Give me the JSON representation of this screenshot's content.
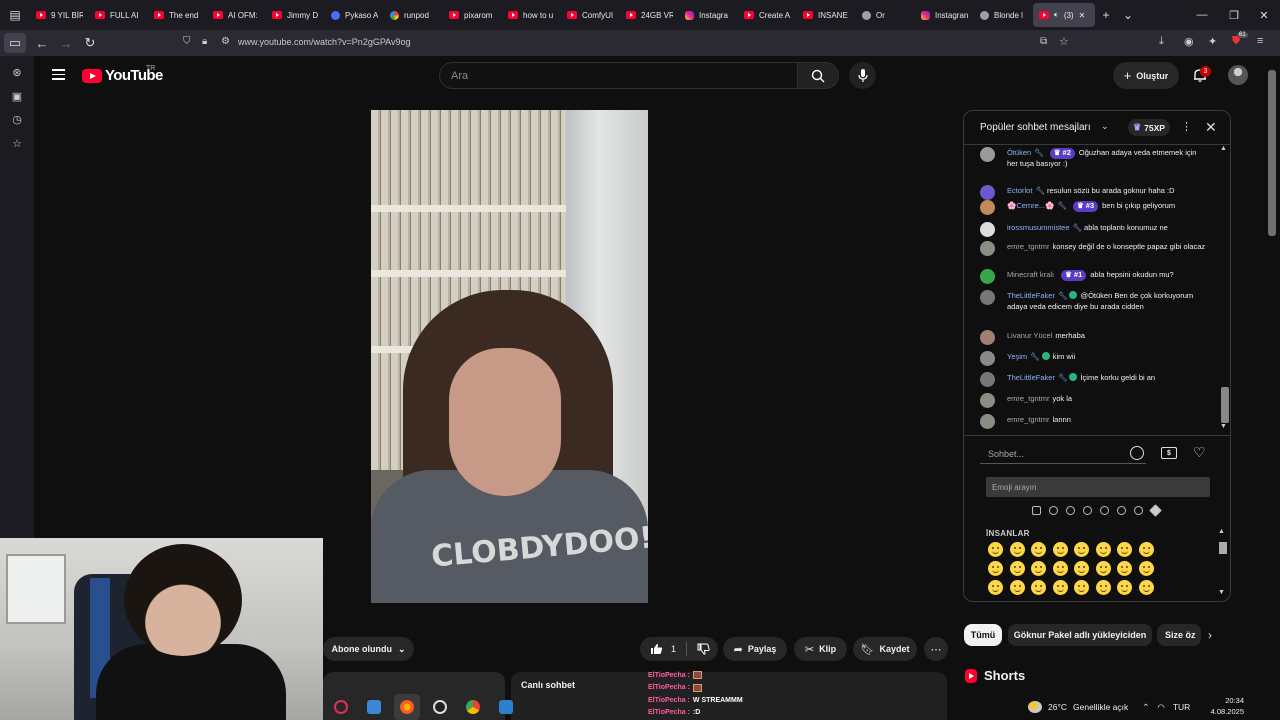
{
  "browser": {
    "tabs": [
      {
        "label": "9 YIL BİR",
        "icon": "youtube"
      },
      {
        "label": "FULL AI",
        "icon": "youtube"
      },
      {
        "label": "The end",
        "icon": "youtube"
      },
      {
        "label": "AI OFM:",
        "icon": "youtube"
      },
      {
        "label": "Jimmy D",
        "icon": "youtube"
      },
      {
        "label": "Pykaso A",
        "icon": "blue"
      },
      {
        "label": "runpod",
        "icon": "google"
      },
      {
        "label": "pixarom",
        "icon": "youtube"
      },
      {
        "label": "how to u",
        "icon": "youtube"
      },
      {
        "label": "ComfyUI",
        "icon": "youtube"
      },
      {
        "label": "24GB VR",
        "icon": "youtube"
      },
      {
        "label": "Instagra",
        "icon": "instagram"
      },
      {
        "label": "Create A",
        "icon": "youtube"
      },
      {
        "label": "INSANE",
        "icon": "youtube"
      },
      {
        "label": "Or",
        "icon": "emoji"
      },
      {
        "label": "Instagran",
        "icon": "instagram"
      },
      {
        "label": "Blonde l",
        "icon": "globe"
      },
      {
        "label": "(3)",
        "icon": "youtube",
        "active": true
      }
    ],
    "url": "www.youtube.com/watch?v=Pn2gGPAv9og",
    "extension_badge": "61"
  },
  "youtube": {
    "logo_text": "YouTube",
    "region": "TR",
    "search_placeholder": "Ara",
    "create_label": "Oluştur",
    "notifications_count": "3"
  },
  "video_actions": {
    "subscribe_label": "Abone olundu",
    "like_count": "1",
    "share_label": "Paylaş",
    "clip_label": "Klip",
    "save_label": "Kaydet"
  },
  "shirt_text": "CLOBDYDOO!",
  "live_chat_collapsed_label": "Canlı sohbet",
  "overlay_chat": [
    {
      "user": "ElTioPecha :",
      "msg": "",
      "emote": true
    },
    {
      "user": "ElTioPecha :",
      "msg": "",
      "emote": true
    },
    {
      "user": "ElTioPecha :",
      "msg": "W STREAMMM",
      "emote": false
    },
    {
      "user": "ElTioPecha :",
      "msg": ":D",
      "emote": false
    }
  ],
  "chat": {
    "title": "Popüler sohbet mesajları",
    "xp": "75XP",
    "messages": [
      {
        "author": "Ötüken",
        "member": true,
        "rank": "#2",
        "text": "Oğuzhan adaya veda etmemek için her tuşa basıyor :)",
        "avatar": "#9a9a9a"
      },
      {
        "author": "Ectorlot",
        "member": true,
        "rank": "",
        "text": "resulun sözü bu arada goknur haha :D",
        "avatar": "#6a5acd"
      },
      {
        "author": "🌸Cemre...🌸",
        "member": true,
        "rank": "#3",
        "text": "ben bi çıkıp geliyorum",
        "avatar": "#c08a5a"
      },
      {
        "author": "irossmusummistee",
        "member": true,
        "rank": "",
        "text": "abla toplantı konumuz ne",
        "avatar": "#dddddd"
      },
      {
        "author": "emre_tgntmr",
        "member": false,
        "rank": "",
        "text": "konsey değil de o konseptle papaz gibi olacaz",
        "avatar": "#8a8f86"
      },
      {
        "author": "Minecraft kralı",
        "member": false,
        "rank": "#1",
        "text": "abla hepsini okudun mu?",
        "avatar": "#3aa64a"
      },
      {
        "author": "TheLittleFaker",
        "member": true,
        "rank": "",
        "gem": true,
        "text": "@Ötüken Ben de çok korkuyorum adaya veda edicem diye bu arada cidden",
        "avatar": "#777777"
      },
      {
        "author": "Livanur Yücel",
        "member": false,
        "rank": "",
        "text": "merhaba",
        "avatar": "#a08070"
      },
      {
        "author": "Yeşim",
        "member": true,
        "rank": "",
        "gem": true,
        "text": "kim wii",
        "avatar": "#8a8a8a"
      },
      {
        "author": "TheLittleFaker",
        "member": true,
        "rank": "",
        "gem": true,
        "text": "İçime korku geldi bi an",
        "avatar": "#777777"
      },
      {
        "author": "emre_tgntmr",
        "member": false,
        "rank": "",
        "text": "yok la",
        "avatar": "#8a8f86"
      },
      {
        "author": "emre_tgntmr",
        "member": false,
        "rank": "",
        "text": "lannn",
        "avatar": "#8a8f86"
      }
    ],
    "input_placeholder": "Sohbet...",
    "emoji_search_placeholder": "Emoji arayın",
    "emoji_category": "İNSANLAR"
  },
  "chips": [
    "Tümü",
    "Göknur Pakel adlı yükleyiciden",
    "Size öz"
  ],
  "shorts_label": "Shorts",
  "taskbar": {
    "weather_temp": "26°C",
    "weather_desc": "Genellikle açık",
    "lang": "TUR",
    "time": "20:34",
    "date": "4.08.2025"
  }
}
